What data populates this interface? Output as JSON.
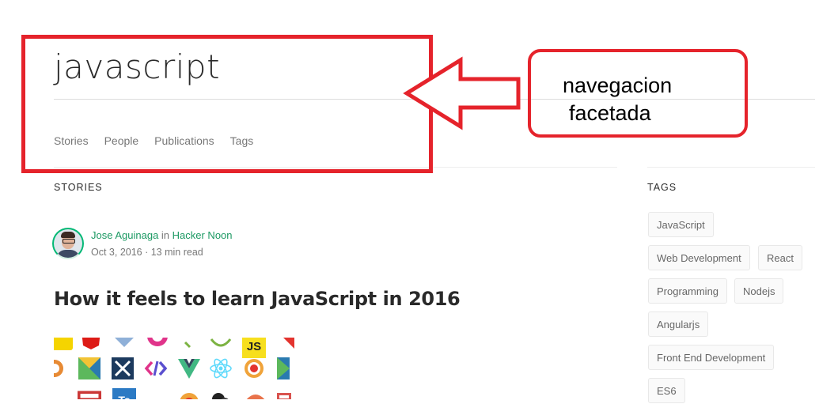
{
  "search": {
    "query": "javascript"
  },
  "facets": {
    "tabs": [
      {
        "label": "Stories"
      },
      {
        "label": "People"
      },
      {
        "label": "Publications"
      },
      {
        "label": "Tags"
      }
    ]
  },
  "stories": {
    "heading": "STORIES",
    "items": [
      {
        "author": "Jose Aguinaga",
        "connector": " in ",
        "publication": "Hacker Noon",
        "date": "Oct 3, 2016",
        "separator": " · ",
        "read_time": "13 min read",
        "title": "How it feels to learn JavaScript in 2016"
      }
    ]
  },
  "tags": {
    "heading": "TAGS",
    "items": [
      {
        "label": "JavaScript"
      },
      {
        "label": "Web Development"
      },
      {
        "label": "React"
      },
      {
        "label": "Programming"
      },
      {
        "label": "Nodejs"
      },
      {
        "label": "Angularjs"
      },
      {
        "label": "Front End Development"
      },
      {
        "label": "ES6"
      }
    ]
  },
  "annotation": {
    "line1": "navegacion",
    "line2": "facetada",
    "color": "#e5232b"
  },
  "colors": {
    "accent_green": "#1c9963",
    "text_muted": "rgba(0,0,0,0.54)",
    "annotation_red": "#e5232b"
  },
  "logos": {
    "js_label": "JS",
    "ts_label": "Ts",
    "icons": [
      "sass-icon",
      "angular-icon",
      "gulp-icon",
      "ember-icon",
      "jsx-icon",
      "javascript-icon",
      "react-icon",
      "vue-icon",
      "webpack-icon",
      "mocha-icon",
      "polymer-icon",
      "npm-icon",
      "typescript-icon",
      "grunt-icon",
      "webstorm-icon",
      "babel-icon"
    ]
  }
}
